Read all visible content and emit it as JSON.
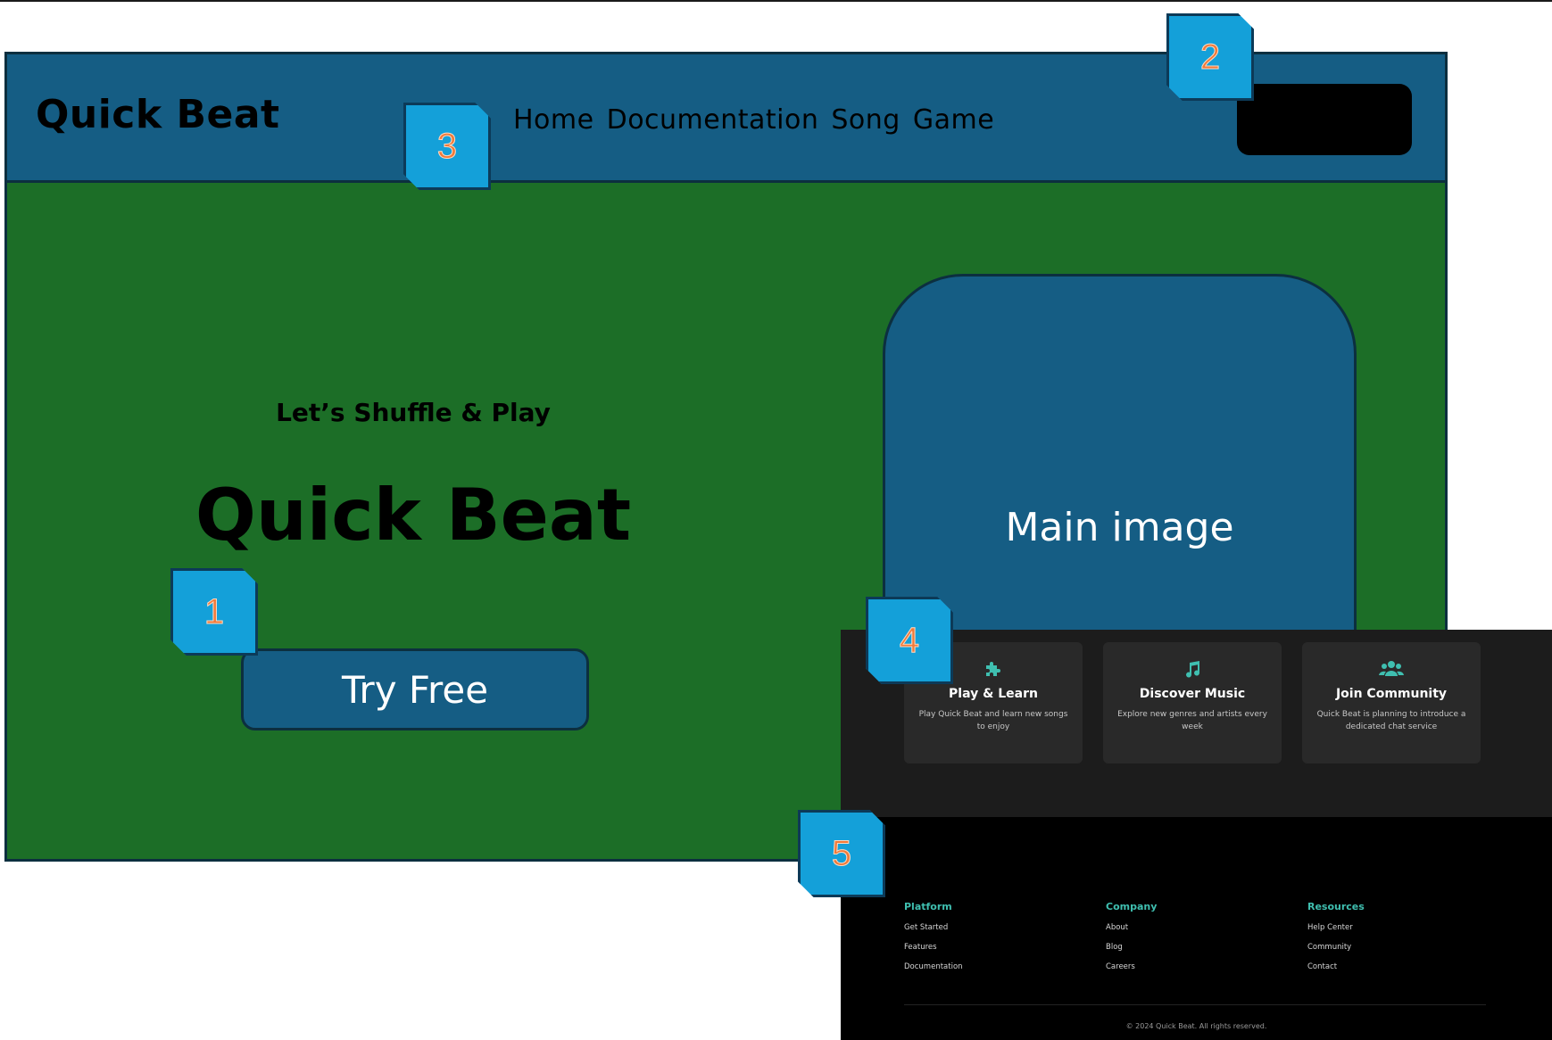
{
  "header": {
    "brand": "Quick Beat",
    "nav": [
      "Home",
      "Documentation",
      "Song",
      "Game"
    ]
  },
  "hero": {
    "tagline": "Let’s Shuffle & Play",
    "title": "Quick Beat",
    "cta_label": "Try Free",
    "image_label": "Main image"
  },
  "features": [
    {
      "icon": "puzzle-icon",
      "title": "Play & Learn",
      "description": "Play Quick Beat and learn new songs to enjoy"
    },
    {
      "icon": "music-note-icon",
      "title": "Discover Music",
      "description": "Explore new genres and artists every week"
    },
    {
      "icon": "users-icon",
      "title": "Join Community",
      "description": "Quick Beat is planning to introduce a dedicated chat service"
    }
  ],
  "footer": {
    "columns": [
      {
        "title": "Platform",
        "links": [
          "Get Started",
          "Features",
          "Documentation"
        ]
      },
      {
        "title": "Company",
        "links": [
          "About",
          "Blog",
          "Careers"
        ]
      },
      {
        "title": "Resources",
        "links": [
          "Help Center",
          "Community",
          "Contact"
        ]
      }
    ],
    "copyright": "© 2024 Quick Beat. All rights reserved."
  },
  "badges": [
    "1",
    "2",
    "3",
    "4",
    "5"
  ],
  "colors": {
    "header_bg": "#155d84",
    "hero_bg": "#1c6e27",
    "badge_bg": "#14a0d9",
    "badge_text": "#f07a3a",
    "footer_accent": "#3fbfb0"
  }
}
